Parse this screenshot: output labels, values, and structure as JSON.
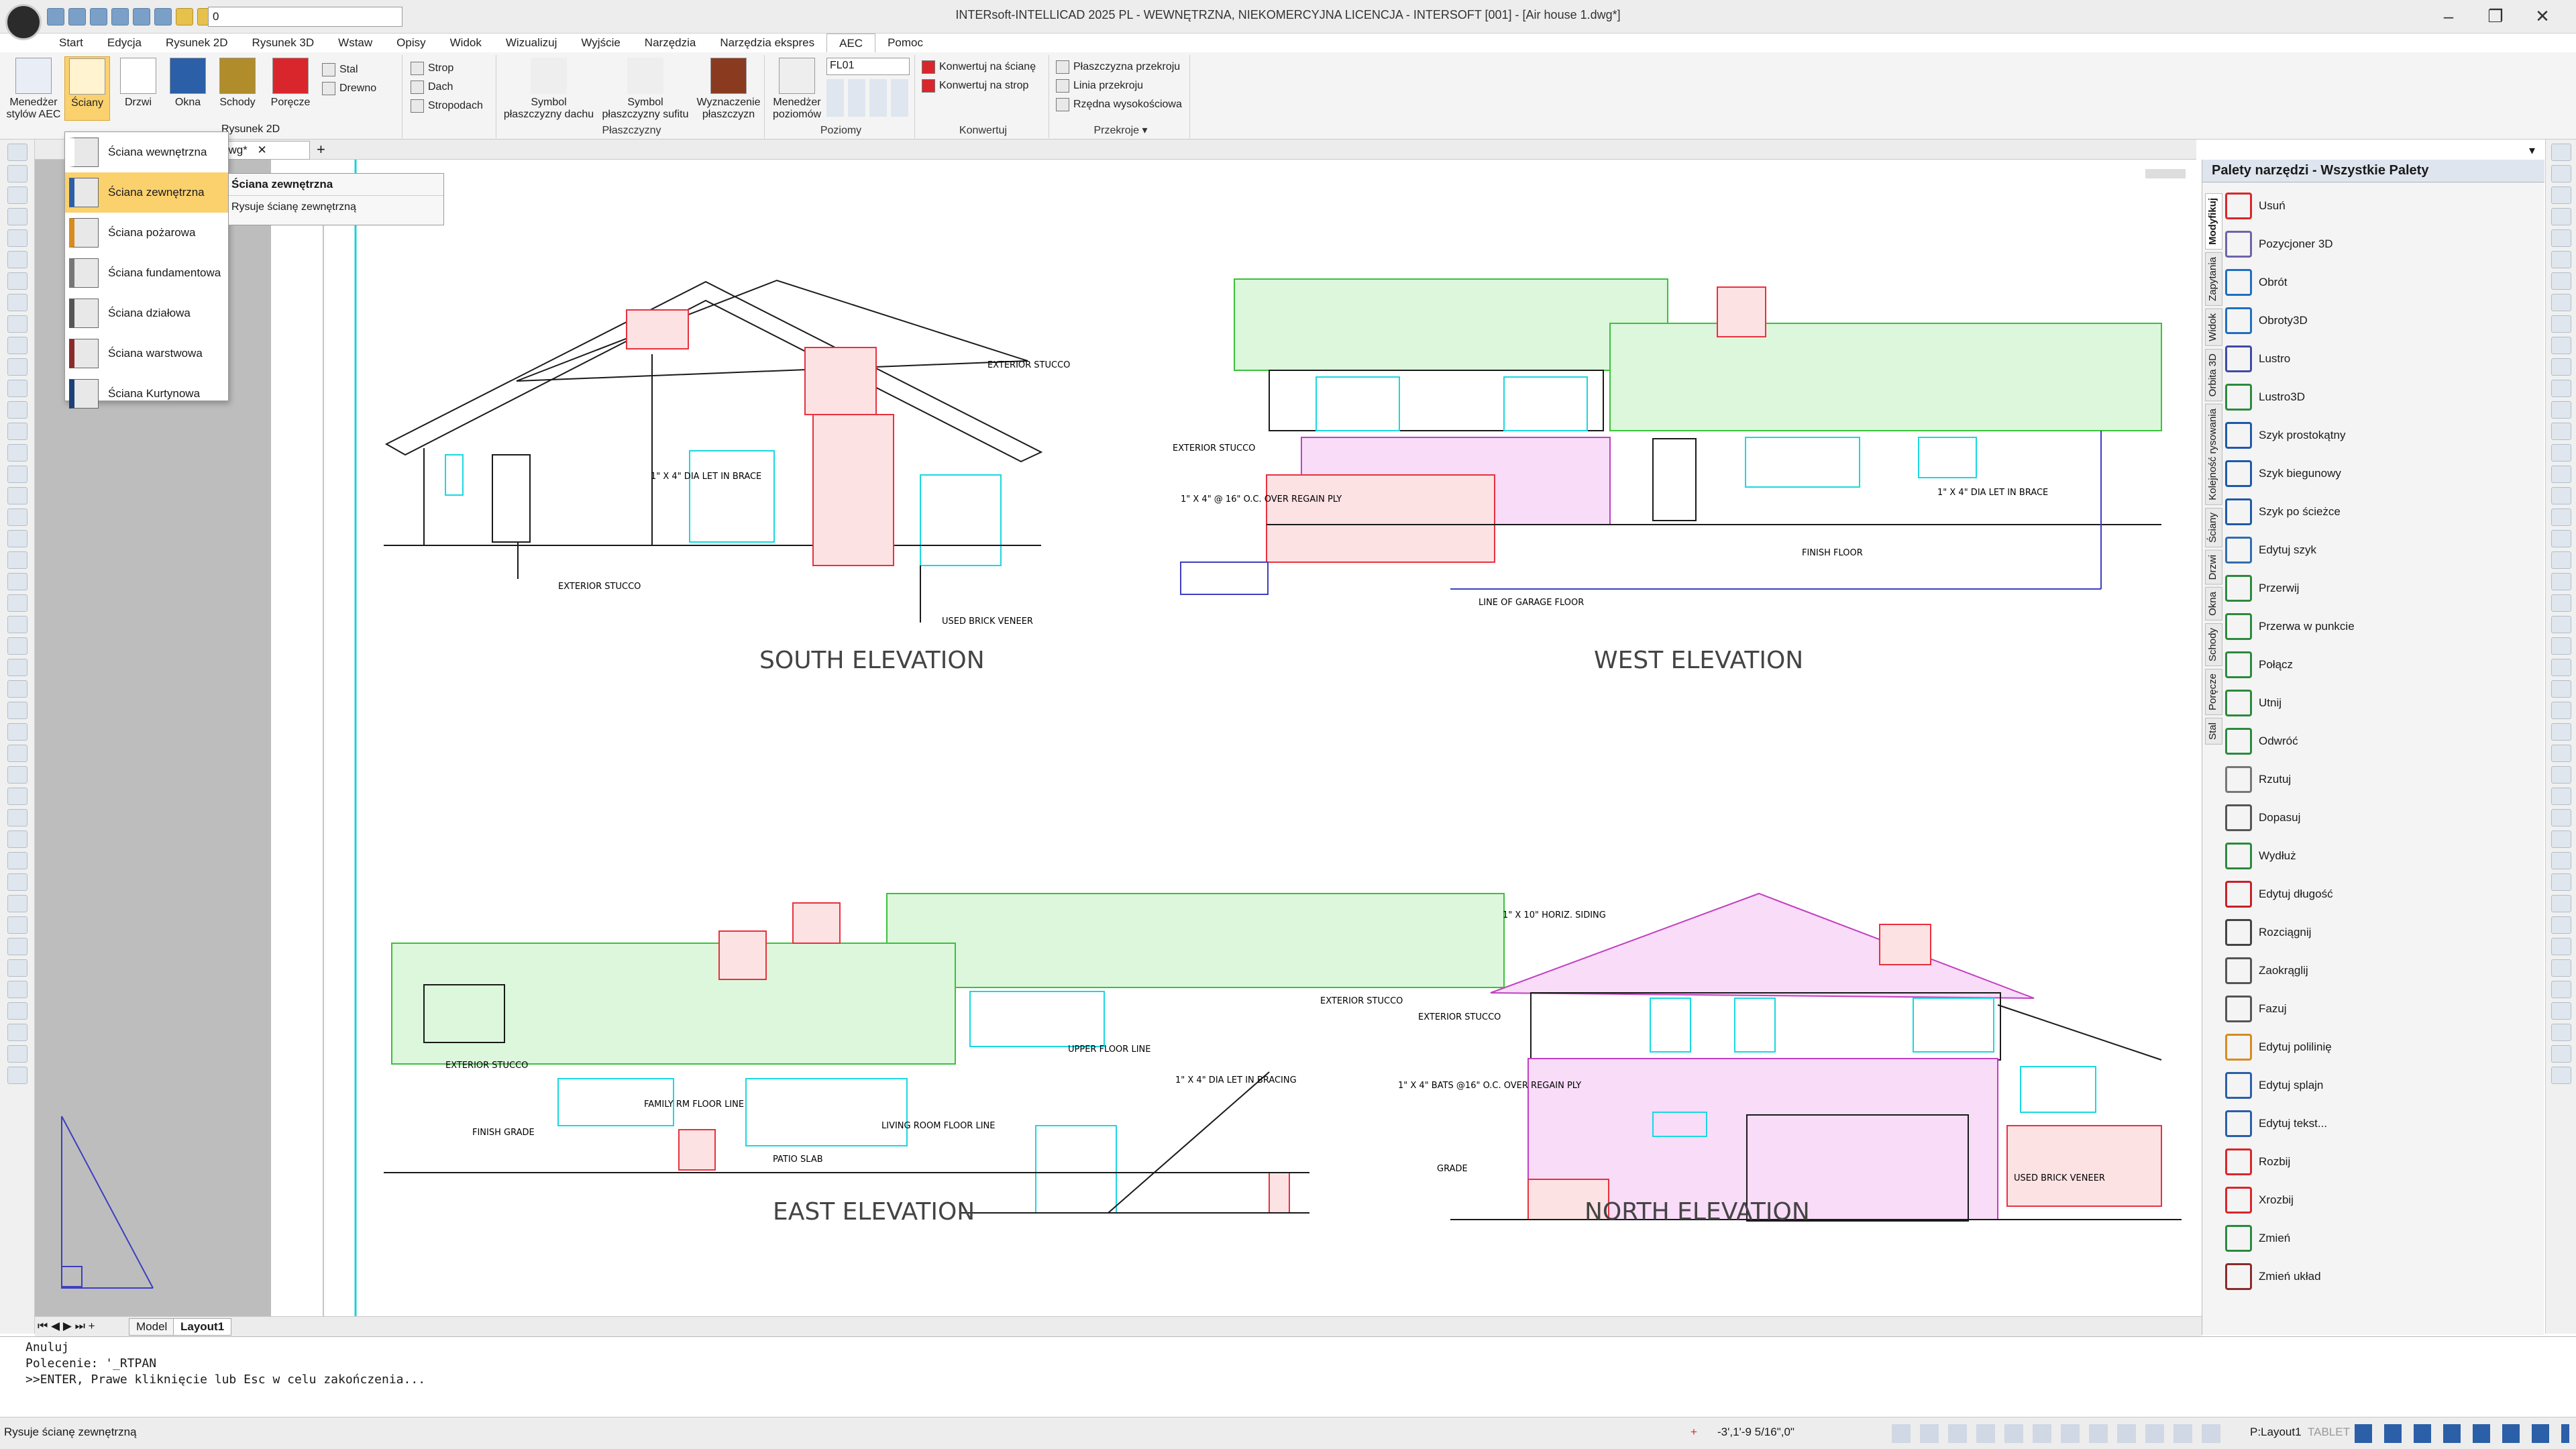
{
  "app": {
    "title": "INTERsoft-INTELLICAD 2025 PL - WEWNĘTRZNA, NIEKOMERCYJNA LICENCJA - INTERSOFT [001] - [Air house 1.dwg*]"
  },
  "quick_access": {
    "layer_value": "0"
  },
  "menu": [
    "Start",
    "Edycja",
    "Rysunek 2D",
    "Rysunek 3D",
    "Wstaw",
    "Opisy",
    "Widok",
    "Wizualizuj",
    "Wyjście",
    "Narzędzia",
    "Narzędzia ekspres",
    "AEC",
    "Pomoc"
  ],
  "menu_active": "AEC",
  "ribbon": {
    "big_buttons": [
      "Menedżer stylów AEC",
      "Ściany",
      "Drzwi",
      "Okna",
      "Schody",
      "Poręcze"
    ],
    "materials": [
      "Stal",
      "Drewno"
    ],
    "slabs": [
      "Strop",
      "Dach",
      "Stropodach"
    ],
    "planes_buttons": [
      "Symbol płaszczyzny dachu",
      "Symbol płaszczyzny sufitu",
      "Wyznaczenie płaszczyzn"
    ],
    "planes_label": "Płaszczyzny",
    "levels_button": "Menedżer poziomów",
    "levels_value": "FL01",
    "levels_label": "Poziomy",
    "convert_items": [
      "Konwertuj na ścianę",
      "Konwertuj na strop"
    ],
    "convert_label": "Konwertuj",
    "sections_items": [
      "Płaszczyzna przekroju",
      "Linia przekroju",
      "Rzędna wysokościowa"
    ],
    "sections_label": "Przekroje ▾",
    "rysunek2d_tab": "Rysunek 2D"
  },
  "doc_tab": {
    "label": "dwg*"
  },
  "dropdown": {
    "items": [
      "Ściana wewnętrzna",
      "Ściana zewnętrzna",
      "Ściana pożarowa",
      "Ściana fundamentowa",
      "Ściana działowa",
      "Ściana warstwowa",
      "Ściana Kurtynowa"
    ],
    "highlighted": "Ściana zewnętrzna"
  },
  "tooltip": {
    "title": "Ściana zewnętrzna",
    "description": "Rysuje ścianę zewnętrzną"
  },
  "drawing": {
    "titles": [
      "SOUTH ELEVATION",
      "WEST ELEVATION",
      "EAST ELEVATION",
      "NORTH ELEVATION"
    ],
    "notes": [
      "EXTERIOR STUCCO",
      "EXTERIOR STUCCO",
      "USED BRICK VENEER",
      "1\" X 4\" DIA LET IN BRACE",
      "EXTERIOR STUCCO",
      "1\" X 4\" @ 16\" O.C. OVER REGAIN PLY",
      "1\" X 4\" DIA LET IN BRACE",
      "FINISH FLOOR",
      "LINE OF GARAGE FLOOR",
      "EXTERIOR STUCCO",
      "EXTERIOR STUCCO",
      "UPPER FLOOR LINE",
      "1\" X 4\" DIA LET IN BRACING",
      "FAMILY RM FLOOR LINE",
      "LIVING ROOM FLOOR LINE",
      "PATIO SLAB",
      "FINISH GRADE",
      "1\" X 10\" HORIZ. SIDING",
      "EXTERIOR STUCCO",
      "1\" X 4\" BATS @16\" O.C. OVER REGAIN PLY",
      "GRADE",
      "USED BRICK VENEER"
    ]
  },
  "palette": {
    "title": "Palety narzędzi - Wszystkie Palety",
    "tabs": [
      "Modyfikuj",
      "Zapytania",
      "Widok",
      "Orbita 3D",
      "Kolejność rysowania",
      "Ściany",
      "Drzwi",
      "Okna",
      "Schody",
      "Poręcze",
      "Stal"
    ],
    "items": [
      "Usuń",
      "Pozycjoner 3D",
      "Obrót",
      "Obroty3D",
      "Lustro",
      "Lustro3D",
      "Szyk prostokątny",
      "Szyk biegunowy",
      "Szyk po ścieżce",
      "Edytuj szyk",
      "Przerwij",
      "Przerwa w punkcie",
      "Połącz",
      "Utnij",
      "Odwróć",
      "Rzutuj",
      "Dopasuj",
      "Wydłuż",
      "Edytuj długość",
      "Rozciągnij",
      "Zaokrąglij",
      "Fazuj",
      "Edytuj polilinię",
      "Edytuj splajn",
      "Edytuj tekst...",
      "Rozbij",
      "Xrozbij",
      "Zmień",
      "Zmień układ"
    ],
    "colors": [
      "#d9262c",
      "#6f63a8",
      "#1f6fbf",
      "#1f6fbf",
      "#3f4aa8",
      "#2b8a3e",
      "#1e5aa8",
      "#1e5aa8",
      "#1e5aa8",
      "#2f6db0",
      "#2b8a3e",
      "#2b8a3e",
      "#2b8a3e",
      "#2b8a3e",
      "#2b8a3e",
      "#777777",
      "#555555",
      "#2b8a3e",
      "#c8202a",
      "#444444",
      "#555555",
      "#555555",
      "#d88b1f",
      "#2b5fa8",
      "#2b5fa8",
      "#d9262c",
      "#d9262c",
      "#2b8a3e",
      "#8a2b2b"
    ]
  },
  "layouts": {
    "model": "Model",
    "layout": "Layout1"
  },
  "command": {
    "lines": [
      "Anuluj",
      "Polecenie: '_RTPAN",
      ">>ENTER, Prawe kliknięcie lub Esc w celu zakończenia..."
    ]
  },
  "status": {
    "left": "Rysuje ścianę zewnętrzną",
    "coords": "-3',1'-9 5/16\",0\"",
    "layout": "P:Layout1",
    "tablet": "TABLET"
  },
  "colors": {
    "brick": "#e8313f",
    "siding_green": "#3bc23b",
    "siding_magenta": "#c040c0",
    "window": "#19d8e0",
    "line": "#1a1a1a"
  }
}
